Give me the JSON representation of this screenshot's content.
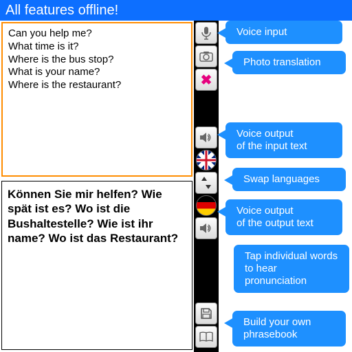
{
  "header": {
    "title": "All features offline!"
  },
  "input_text": "Can you help me?\nWhat time is it?\nWhere is the bus stop?\nWhat is your name?\nWhere is the restaurant?",
  "output_text": "Können Sie mir helfen? Wie spät ist es? Wo ist die Bushaltestelle? Wie ist ihr name? Wo ist das Restaurant?",
  "callouts": {
    "voice_input": "Voice input",
    "photo_translation": "Photo translation",
    "voice_output_input": "Voice output\nof the input text",
    "swap_languages": "Swap languages",
    "voice_output_output": "Voice output\nof the output text",
    "tap_words": "Tap individual words\nto hear pronunciation",
    "phrasebook": "Build your own\nphrasebook"
  },
  "colors": {
    "accent": "#1e90ff",
    "header": "#0d6fff",
    "input_border": "#ff8c00",
    "close_x": "#e6007e"
  }
}
